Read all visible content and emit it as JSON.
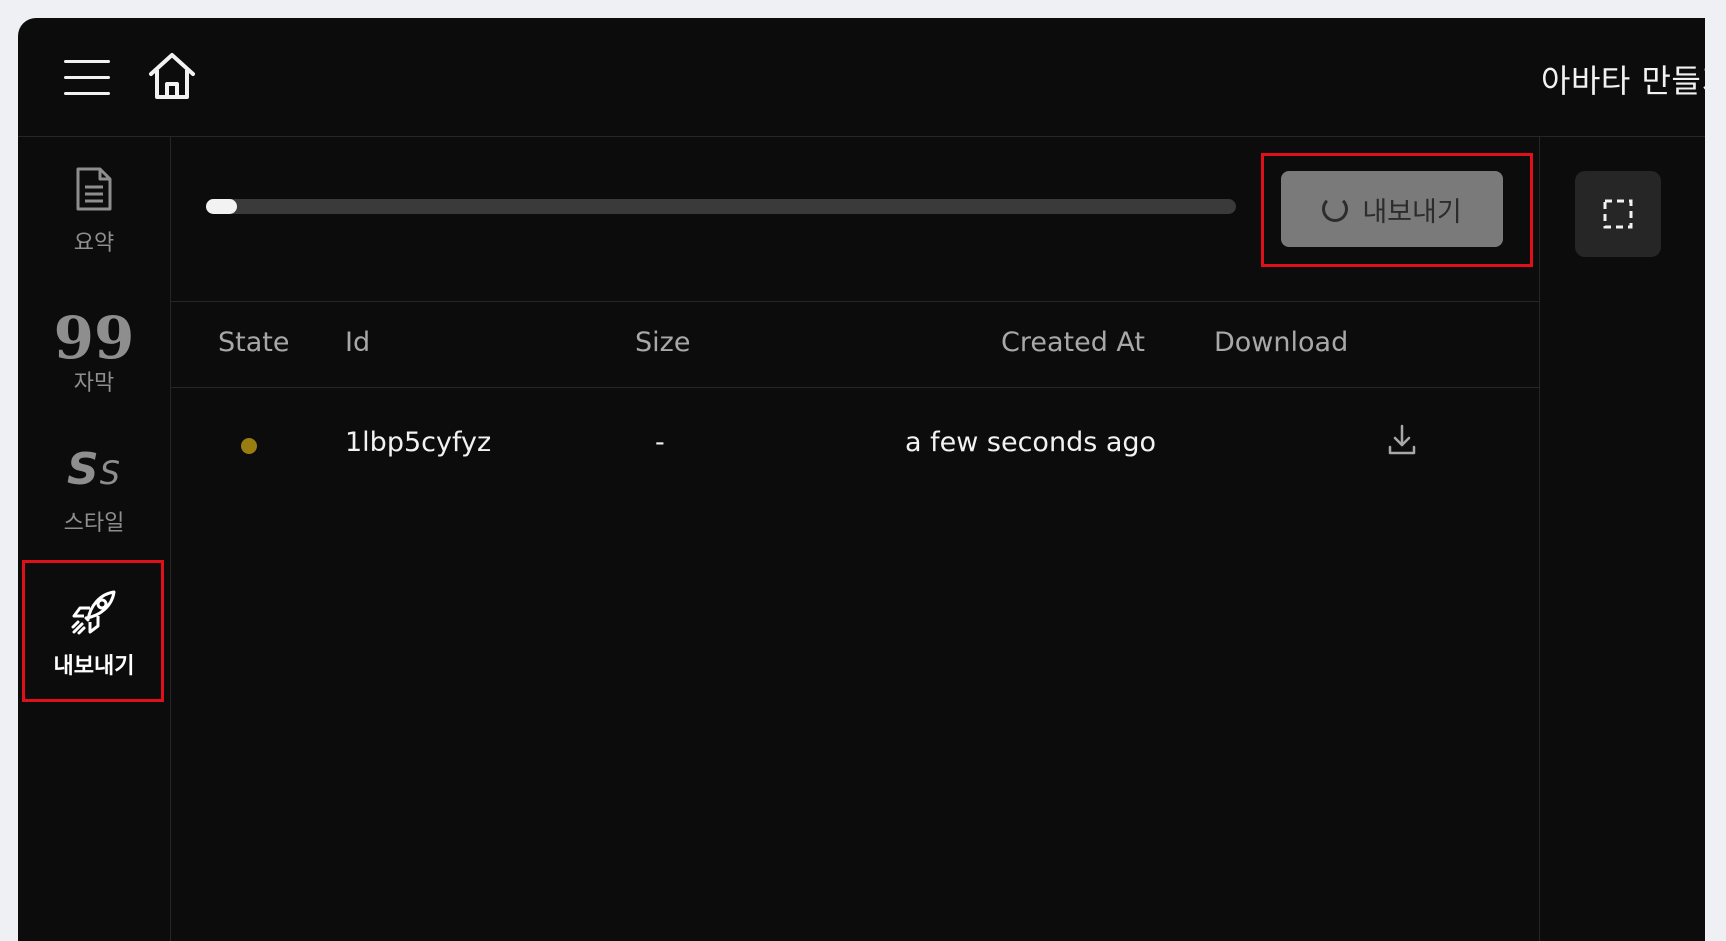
{
  "header": {
    "title": "아바타 만들기",
    "menu_icon": "hamburger-menu-icon",
    "home_icon": "home-icon"
  },
  "sidebar": {
    "items": [
      {
        "label": "요약",
        "icon": "document-icon",
        "active": false
      },
      {
        "label": "자막",
        "icon": "quote-icon",
        "glyph": "99",
        "active": false
      },
      {
        "label": "스타일",
        "icon": "style-icon",
        "glyph_big": "S",
        "glyph_small": "S",
        "active": true
      },
      {
        "label": "내보내기",
        "icon": "rocket-icon",
        "active": true
      }
    ]
  },
  "export": {
    "progress": 0.03,
    "button_label": "내보내기",
    "button_icon": "spinner-icon",
    "highlight_color": "#e0101a"
  },
  "table": {
    "headers": [
      "State",
      "Id",
      "Size",
      "Created At",
      "Download"
    ],
    "rows": [
      {
        "state": "pending",
        "state_color": "#9a7d10",
        "id": "1lbp5cyfyz",
        "size": "-",
        "created_at": "a few seconds ago",
        "download_icon": "download-icon"
      }
    ]
  },
  "right_panel": {
    "icon": "frame-select-icon"
  }
}
